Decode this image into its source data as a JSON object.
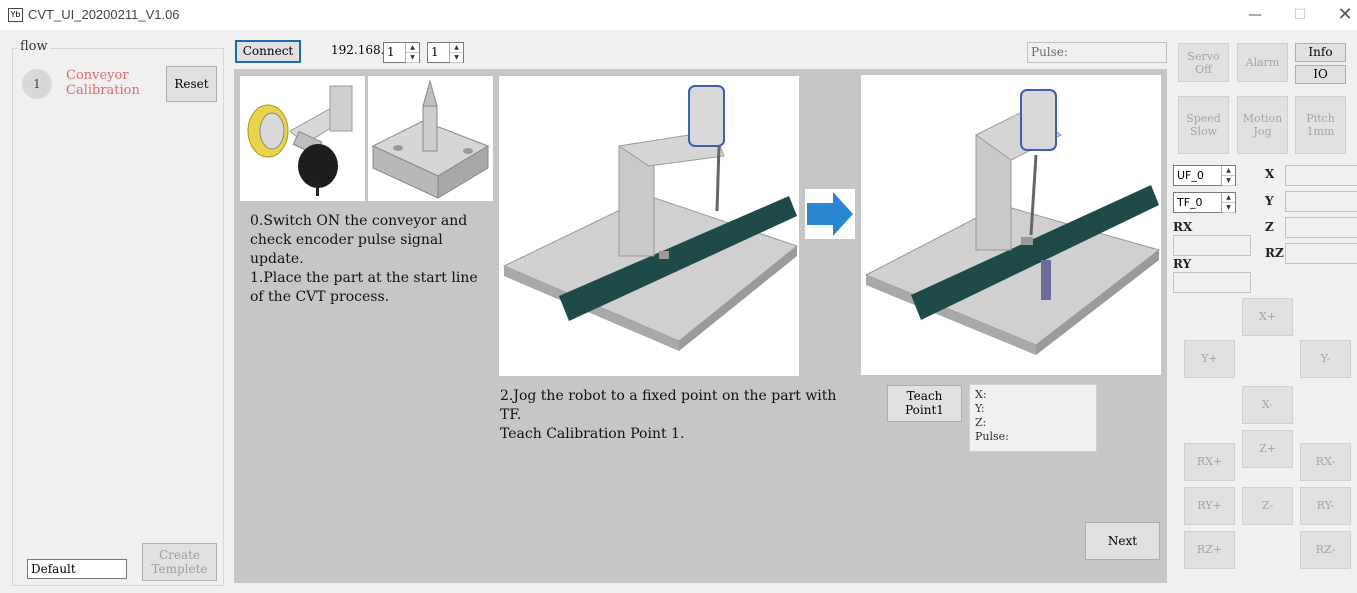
{
  "window": {
    "title": "CVT_UI_20200211_V1.06",
    "icon_text": "Yb",
    "minimize_glyph": "—",
    "maximize_glyph": "☐",
    "close_glyph": "✕"
  },
  "flow": {
    "legend": "flow",
    "step_number": "1",
    "step_label": "Conveyor Calibration",
    "reset_label": "Reset",
    "template_value": "Default",
    "create_label": "Create Templete"
  },
  "connection": {
    "connect_label": "Connect",
    "ip_prefix": "192.168.",
    "ip_part3": "1",
    "ip_part4": "1",
    "pulse_label": "Pulse:"
  },
  "main": {
    "instruction_1": "0.Switch ON the conveyor and check encoder pulse signal update.\n1.Place the part at the start line of the CVT process.",
    "instruction_2": "2.Jog the robot to a fixed point on the part with TF.\nTeach Calibration Point 1.",
    "teach_label": "Teach Point1",
    "coord_x_label": "X:",
    "coord_y_label": "Y:",
    "coord_z_label": "Z:",
    "coord_pulse_label": "Pulse:",
    "next_label": "Next",
    "arrow_color": "#2b86d1"
  },
  "panel": {
    "servo_label": "Servo Off",
    "alarm_label": "Alarm",
    "info_label": "Info",
    "io_label": "IO",
    "speed_label": "Speed Slow",
    "motion_label": "Motion Jog",
    "pitch_label": "Pitch 1mm",
    "uf_value": "UF_0",
    "tf_value": "TF_0",
    "axis_labels": {
      "x": "X",
      "y": "Y",
      "z": "Z",
      "rz": "RZ",
      "rx": "RX",
      "ry": "RY"
    },
    "jog": {
      "x_plus": "X+",
      "y_plus": "Y+",
      "y_minus": "Y-",
      "x_minus": "X-",
      "z_plus": "Z+",
      "rx_plus": "RX+",
      "rx_minus": "RX-",
      "ry_plus": "RY+",
      "z_minus": "Z-",
      "ry_minus": "RY-",
      "rz_plus": "RZ+",
      "rz_minus": "RZ-"
    }
  }
}
